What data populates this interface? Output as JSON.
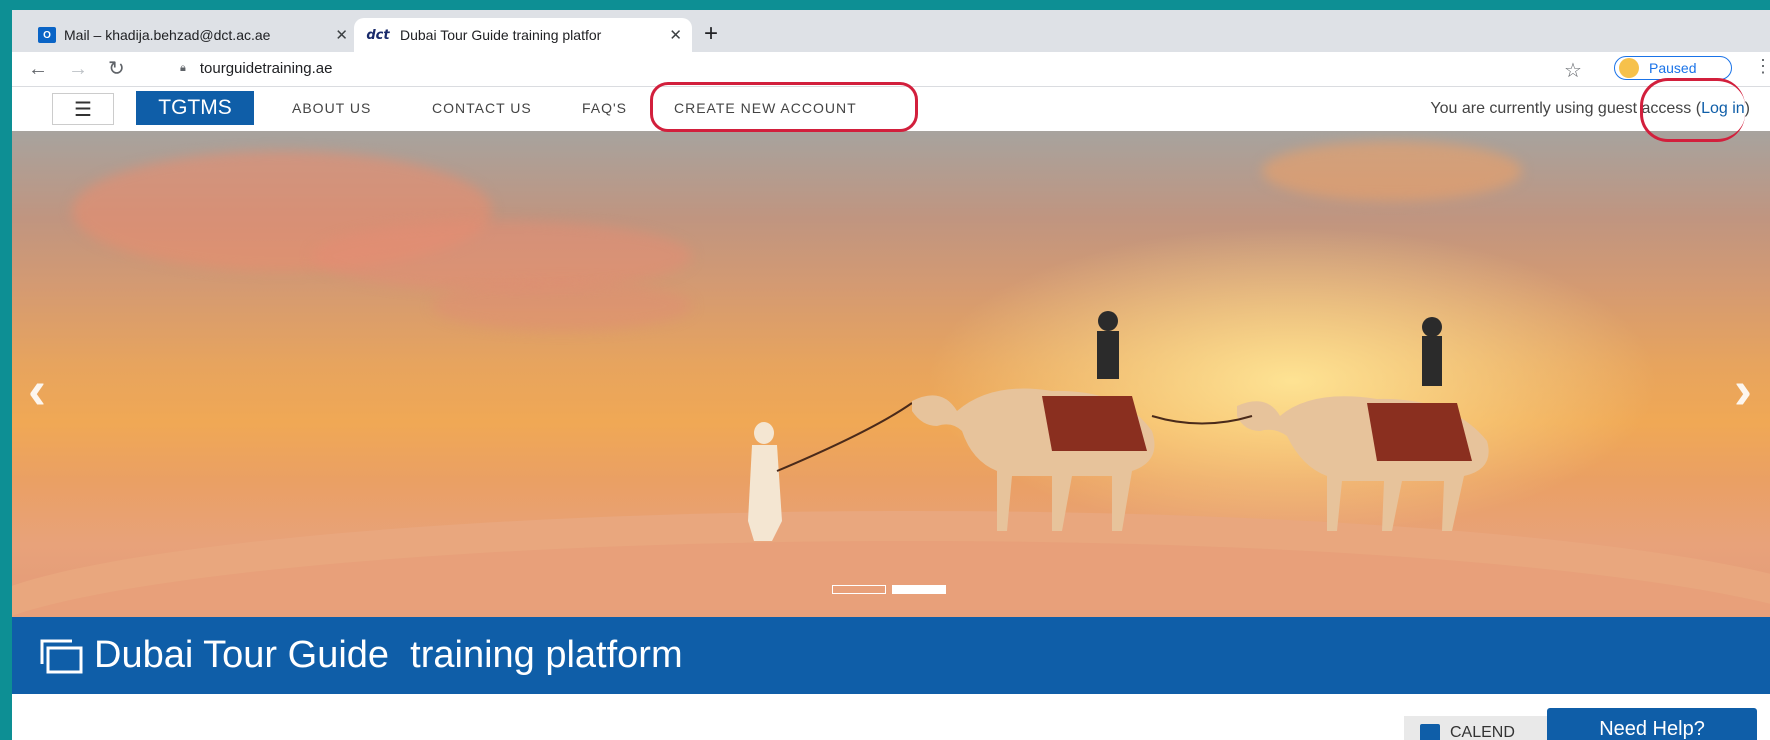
{
  "browser": {
    "tabs": [
      {
        "title": "Mail – khadija.behzad@dct.ac.ae",
        "close": "✕",
        "icon": "outlook-icon"
      },
      {
        "title": "Dubai Tour Guide  training platfor",
        "close": "✕",
        "icon": "dct-icon",
        "favicon_text": "dct"
      }
    ],
    "new_tab": "+",
    "url": "tourguidetraining.ae",
    "profile_status": "Paused"
  },
  "site_nav": {
    "brand": "TGTMS",
    "links": [
      "ABOUT US",
      "CONTACT US",
      "FAQ'S",
      "CREATE NEW ACCOUNT"
    ],
    "guest_text": "You are currently using guest access",
    "login_text": "Log in"
  },
  "hero": {
    "prev": "‹",
    "next": "›",
    "slides": 2,
    "active_slide": 2
  },
  "banner": {
    "title": "Dubai Tour Guide  training platform"
  },
  "footer": {
    "calendar_label": "CALEND",
    "help_label": "Need Help?"
  },
  "colors": {
    "brand_blue": "#0f5ea8",
    "annotation_red": "#d21f3c",
    "outer_teal": "#0d8f94"
  }
}
